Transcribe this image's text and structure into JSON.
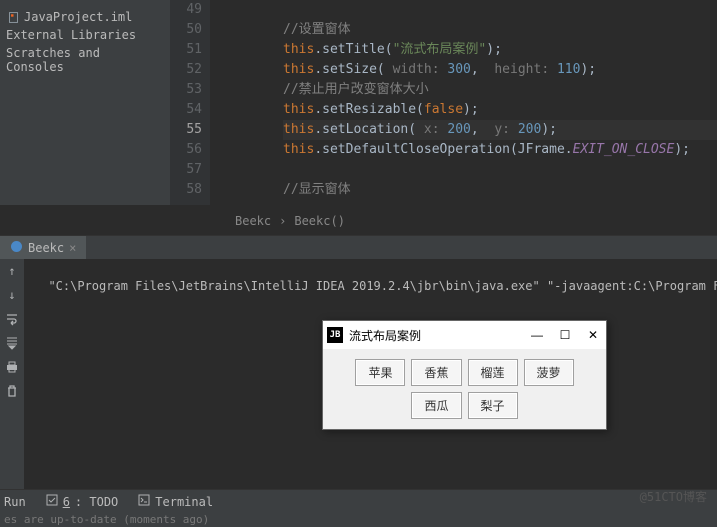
{
  "project": {
    "items": [
      {
        "label": "JavaProject.iml",
        "icon": "file"
      },
      {
        "label": "External Libraries",
        "icon": "lib"
      },
      {
        "label": "Scratches and Consoles",
        "icon": "scratch"
      }
    ]
  },
  "editor": {
    "line_start": 49,
    "current_line": 55,
    "breadcrumb": [
      "Beekc",
      "Beekc()"
    ],
    "code": {
      "c49": "//设置窗体",
      "c50_pre": "this",
      "c50_mth": ".setTitle(",
      "c50_str": "\"流式布局案例\"",
      "c50_end": ");",
      "c51_pre": "this",
      "c51_mth": ".setSize(",
      "c51_h1": " width: ",
      "c51_n1": "300",
      "c51_cm": ", ",
      "c51_h2": " height: ",
      "c51_n2": "110",
      "c51_end": ");",
      "c52": "//禁止用户改变窗体大小",
      "c53_pre": "this",
      "c53_mth": ".setResizable(",
      "c53_kw": "false",
      "c53_end": ");",
      "c54_pre": "this",
      "c54_mth": ".setLocation(",
      "c54_h1": " x: ",
      "c54_n1": "200",
      "c54_cm": ", ",
      "c54_h2": " y: ",
      "c54_n2": "200",
      "c54_end": ");",
      "c55_pre": "this",
      "c55_mth": ".setDefaultCloseOperation(JFrame.",
      "c55_fld": "EXIT_ON_CLOSE",
      "c55_end": ");",
      "c57": "//显示窗体"
    }
  },
  "console": {
    "tab_label": "Beekc",
    "output": "\"C:\\Program Files\\JetBrains\\IntelliJ IDEA 2019.2.4\\jbr\\bin\\java.exe\" \"-javaagent:C:\\Program Files\\"
  },
  "bottom": {
    "run": "Run",
    "todo_underline": "6",
    "todo": ": TODO",
    "terminal": "Terminal"
  },
  "status": "es are up-to-date (moments ago)",
  "java_window": {
    "title": "流式布局案例",
    "buttons": [
      "苹果",
      "香蕉",
      "榴莲",
      "菠萝",
      "西瓜",
      "梨子"
    ]
  },
  "watermark": "@51CTO博客"
}
